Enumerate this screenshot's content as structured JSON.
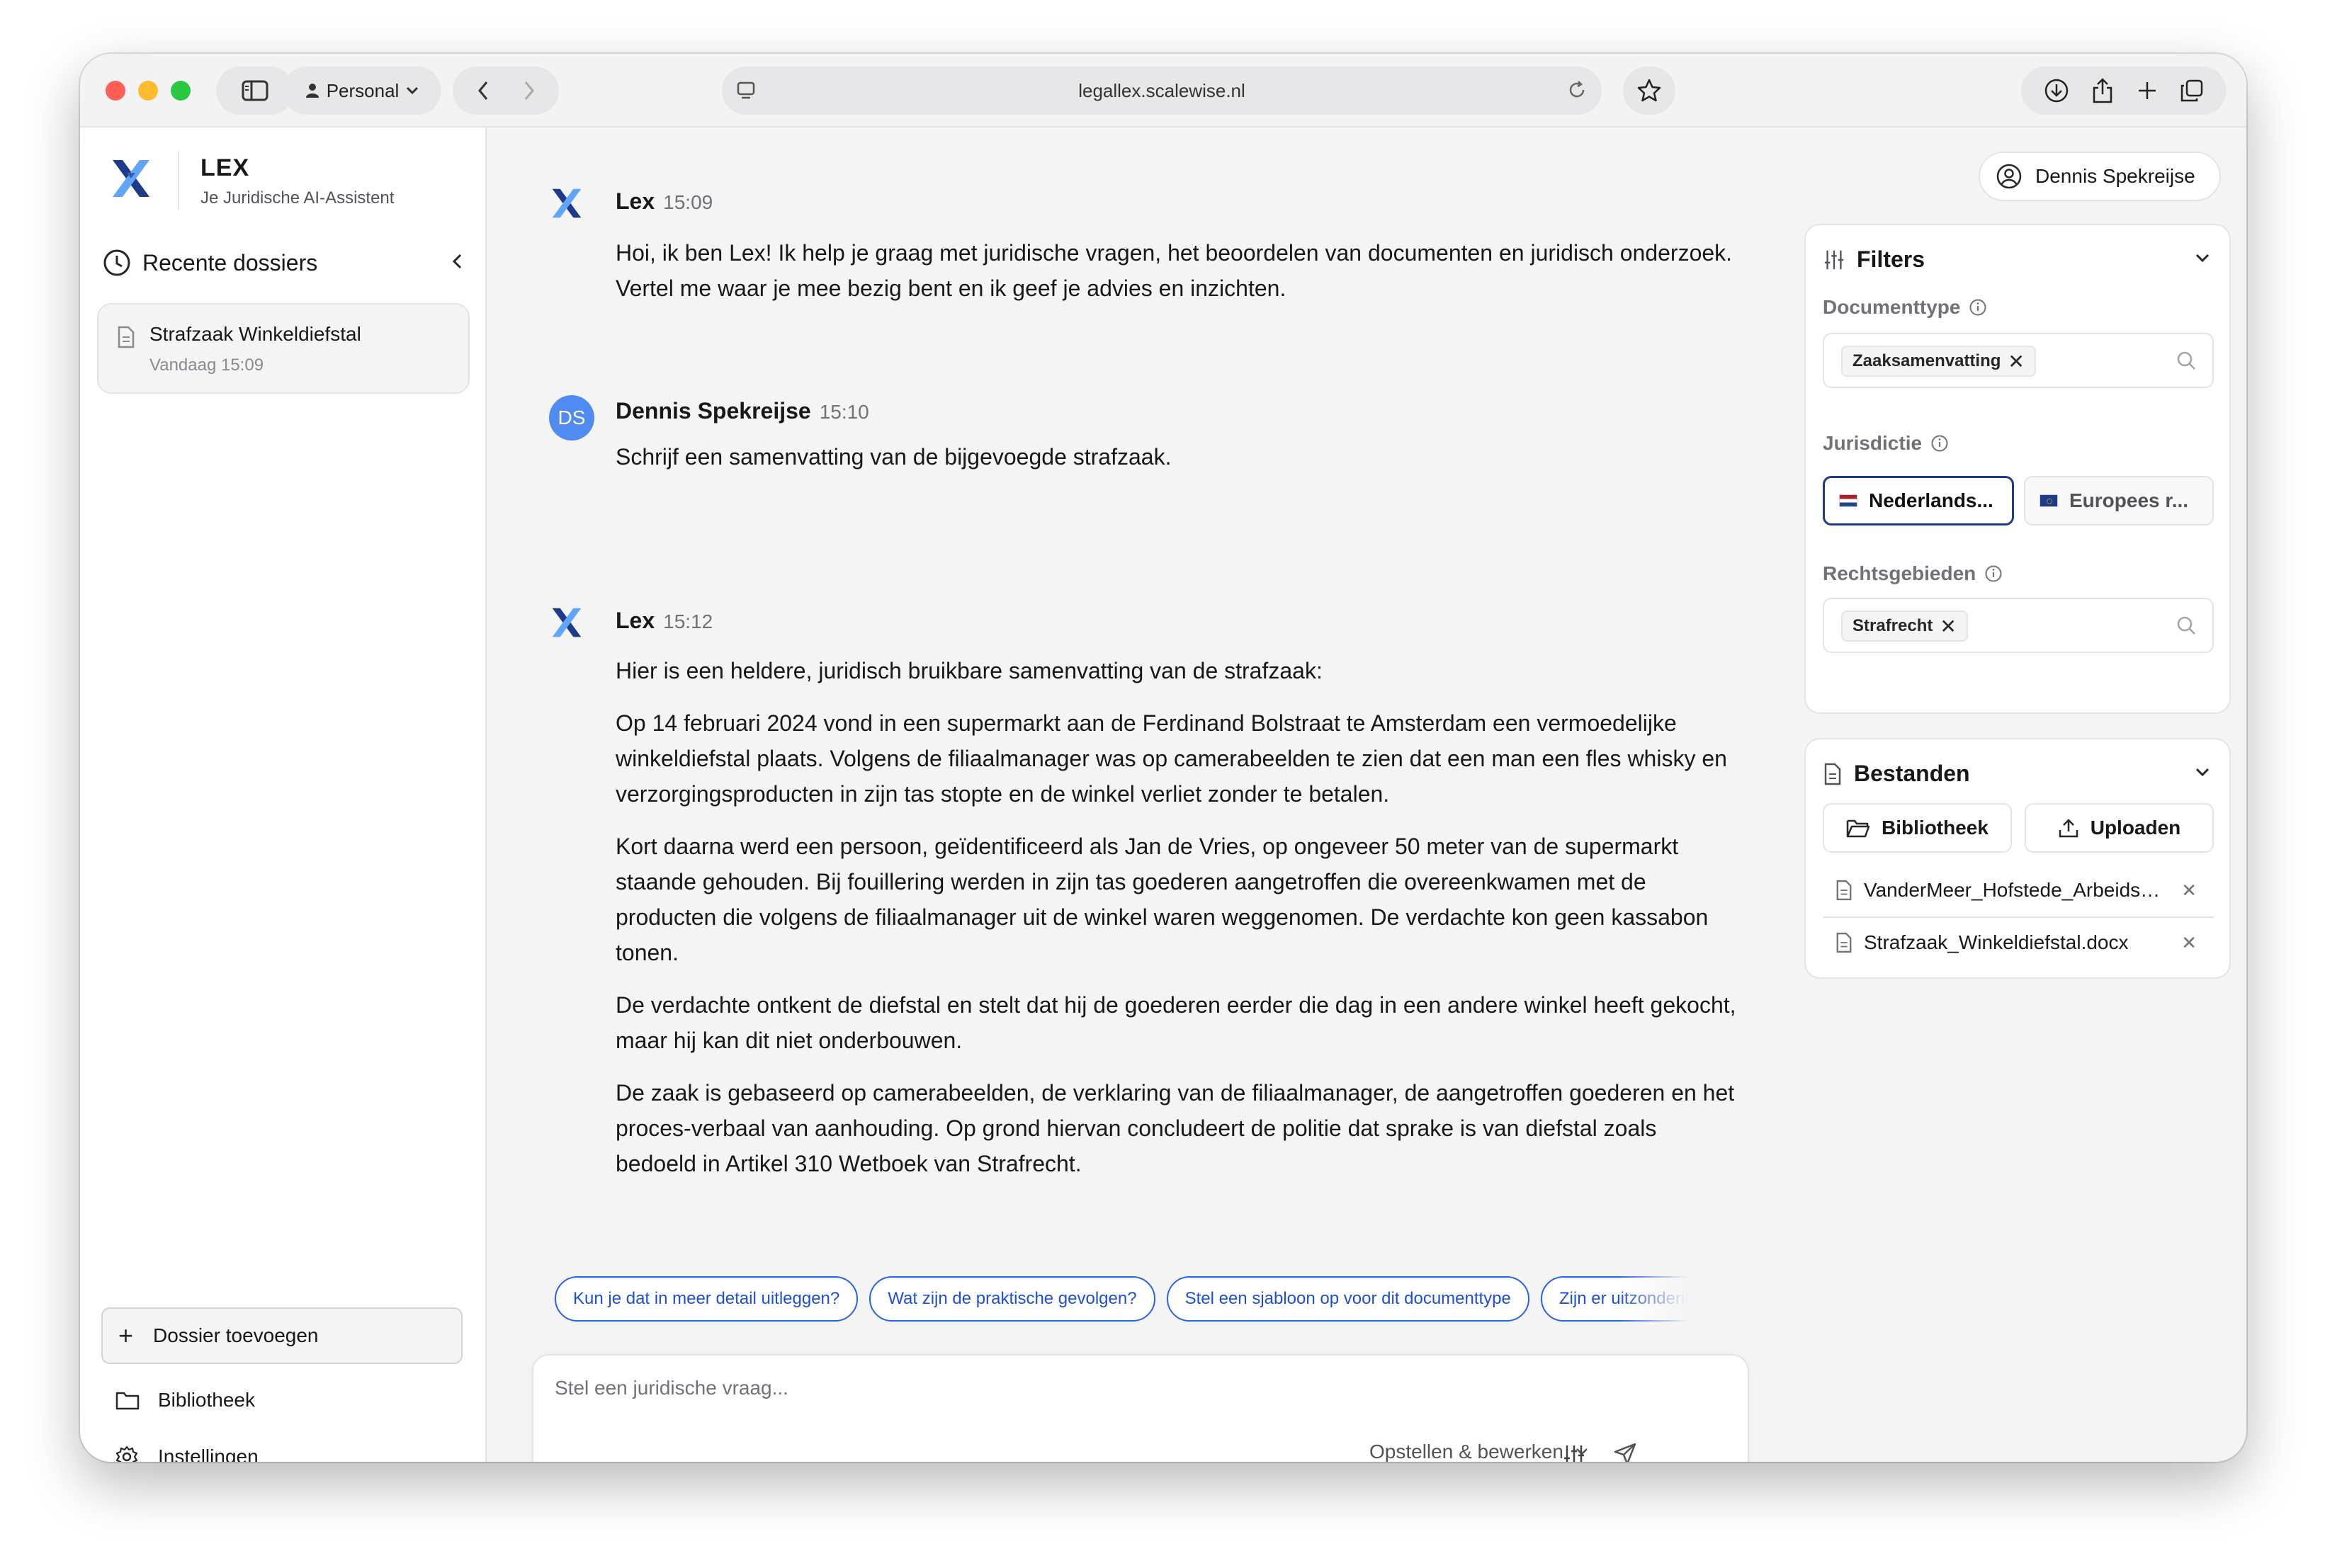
{
  "browser": {
    "profile": "Personal",
    "url": "legallex.scalewise.nl"
  },
  "sidebar": {
    "brand_name": "LEX",
    "brand_subtitle": "Je Juridische AI-Assistent",
    "recent_heading": "Recente dossiers",
    "dossiers": [
      {
        "title": "Strafzaak Winkeldiefstal",
        "time": "Vandaag 15:09"
      }
    ],
    "add_dossier": "Dossier toevoegen",
    "library": "Bibliotheek",
    "settings": "Instellingen"
  },
  "chat": {
    "messages": [
      {
        "sender": "Lex",
        "time": "15:09",
        "paragraphs": [
          "Hoi, ik ben Lex! Ik help je graag met juridische vragen, het beoordelen van documenten en juridisch onderzoek. Vertel me waar je mee bezig bent en ik geef je advies en inzichten."
        ]
      },
      {
        "sender": "Dennis Spekreijse",
        "initials": "DS",
        "time": "15:10",
        "paragraphs": [
          "Schrijf een samenvatting van de bijgevoegde strafzaak."
        ]
      },
      {
        "sender": "Lex",
        "time": "15:12",
        "paragraphs": [
          "Hier is een heldere, juridisch bruikbare samenvatting van de strafzaak:",
          "Op 14 februari 2024 vond in een supermarkt aan de Ferdinand Bolstraat te Amsterdam een vermoedelijke winkeldiefstal plaats. Volgens de filiaalmanager was op camerabeelden te zien dat een man een fles whisky en verzorgingsproducten in zijn tas stopte en de winkel verliet zonder te betalen.",
          "Kort daarna werd een persoon, geïdentificeerd als Jan de Vries, op ongeveer 50 meter van de supermarkt staande gehouden. Bij fouillering werden in zijn tas goederen aangetroffen die overeenkwamen met de producten die volgens de filiaalmanager uit de winkel waren weggenomen. De verdachte kon geen kassabon tonen.",
          "De verdachte ontkent de diefstal en stelt dat hij de goederen eerder die dag in een andere winkel heeft gekocht, maar hij kan dit niet onderbouwen.",
          "De zaak is gebaseerd op camerabeelden, de verklaring van de filiaalmanager, de aangetroffen goederen en het proces-verbaal van aanhouding. Op grond hiervan concludeert de politie dat sprake is van diefstal zoals bedoeld in Artikel 310 Wetboek van Strafrecht."
        ]
      }
    ],
    "suggestions": [
      "Kun je dat in meer detail uitleggen?",
      "Wat zijn de praktische gevolgen?",
      "Stel een sjabloon op voor dit documenttype",
      "Zijn er uitzonderingen?"
    ],
    "composer_placeholder": "Stel een juridische vraag...",
    "mode": "Opstellen & bewerken"
  },
  "right_panel": {
    "user": "Dennis Spekreijse",
    "filters": {
      "title": "Filters",
      "doctype_label": "Documenttype",
      "doctype_tag": "Zaaksamenvatting",
      "jurisdiction_label": "Jurisdictie",
      "jurisdictions": [
        "Nederlands...",
        "Europees r..."
      ],
      "areas_label": "Rechtsgebieden",
      "areas_tag": "Strafrecht"
    },
    "files": {
      "title": "Bestanden",
      "library_button": "Bibliotheek",
      "upload_button": "Uploaden",
      "items": [
        "VanderMeer_Hofstede_Arbeidsovereenkomst.docx",
        "Strafzaak_Winkeldiefstal.docx"
      ]
    }
  },
  "colors": {
    "accent": "#2563eb",
    "selected_border": "#1e3a8a",
    "avatar_blue": "#4f8bf0",
    "logo_dark": "#1e3a8a",
    "logo_light": "#60a5fa"
  }
}
